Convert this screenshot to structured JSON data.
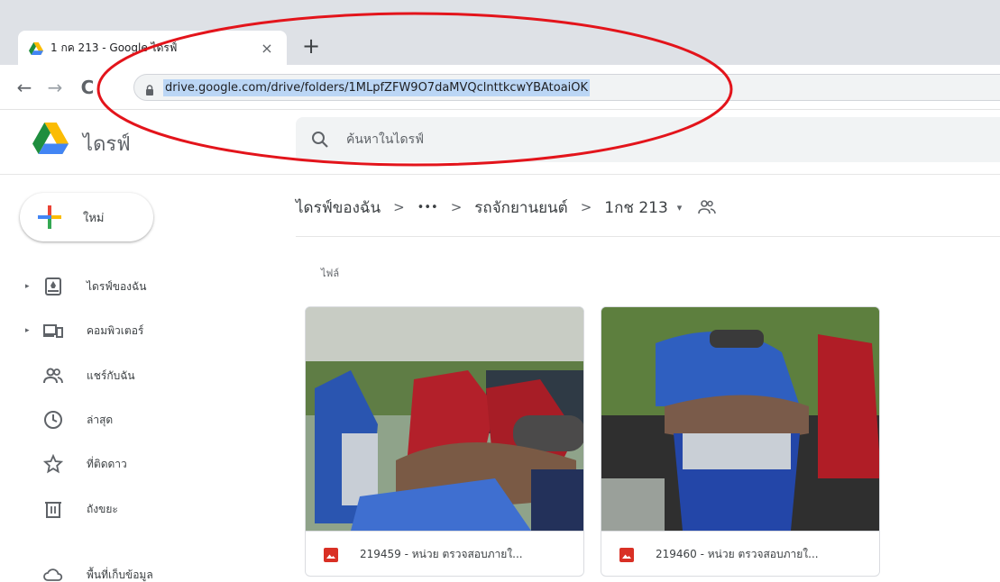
{
  "browser": {
    "tab_title": "1 กค 213 - Google ไดรฟ์",
    "tab_close": "×",
    "new_tab": "+",
    "back": "←",
    "forward": "→",
    "reload": "C",
    "url": "drive.google.com/drive/folders/1MLpfZFW9O7daMVQclnttkcwYBAtoaiOK"
  },
  "drive": {
    "logo_text": "ไดรฟ์",
    "search_placeholder": "ค้นหาในไดรฟ์",
    "new_label": "ใหม่",
    "nav": [
      {
        "label": "ไดรฟ์ของฉัน",
        "icon": "drive-icon",
        "caret": "▸"
      },
      {
        "label": "คอมพิวเตอร์",
        "icon": "computer-icon",
        "caret": "▸"
      },
      {
        "label": "แชร์กับฉัน",
        "icon": "shared-icon",
        "caret": ""
      },
      {
        "label": "ล่าสุด",
        "icon": "clock-icon",
        "caret": ""
      },
      {
        "label": "ที่ติดดาว",
        "icon": "star-icon",
        "caret": ""
      },
      {
        "label": "ถังขยะ",
        "icon": "trash-icon",
        "caret": ""
      },
      {
        "label": "พื้นที่เก็บข้อมูล",
        "icon": "cloud-icon",
        "caret": ""
      }
    ],
    "breadcrumb": {
      "items": [
        "ไดรฟ์ของฉัน",
        "•••",
        "รถจักยานยนต์",
        "1กช 213"
      ],
      "separator": ">",
      "dropdown": "▾"
    },
    "section_label": "ไฟล์",
    "files": [
      {
        "name": "219459 - หน่วย ตรวจสอบภายใ..."
      },
      {
        "name": "219460 - หน่วย ตรวจสอบภายใ..."
      }
    ]
  },
  "colors": {
    "annotation": "#e3141b",
    "url_highlight": "#bbd6f5",
    "image_icon": "#d93025"
  }
}
